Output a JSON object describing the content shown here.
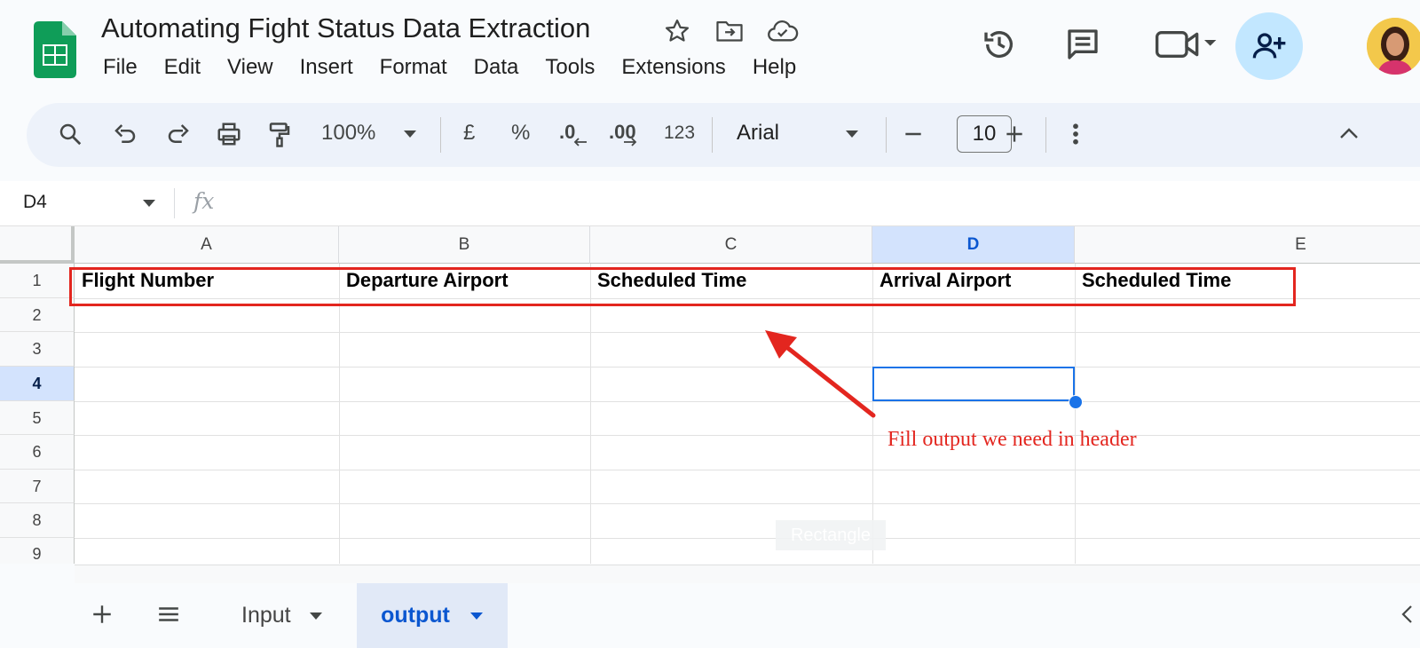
{
  "document": {
    "title": "Automating Fight Status Data Extraction"
  },
  "menu": [
    "File",
    "Edit",
    "View",
    "Insert",
    "Format",
    "Data",
    "Tools",
    "Extensions",
    "Help"
  ],
  "toolbar": {
    "zoom": "100%",
    "currency": "£",
    "percent": "%",
    "decrease_decimal": ".0",
    "increase_decimal": ".00",
    "number_format": "123",
    "font": "Arial",
    "font_size": "10"
  },
  "formula_bar": {
    "name_box": "D4",
    "fx": "fx",
    "formula": ""
  },
  "grid": {
    "columns": [
      "A",
      "B",
      "C",
      "D",
      "E"
    ],
    "selected_column": "D",
    "rows": [
      "1",
      "2",
      "3",
      "4",
      "5",
      "6",
      "7",
      "8",
      "9"
    ],
    "selected_row": "4",
    "header_row": [
      "Flight Number",
      "Departure Airport",
      "Scheduled Time",
      "Arrival Airport",
      "Scheduled Time"
    ]
  },
  "annotation": {
    "text": "Fill output we need in header",
    "color": "#e3261f"
  },
  "watermark": "Rectangle",
  "sheets": {
    "tabs": [
      {
        "label": "Input",
        "active": false
      },
      {
        "label": "output",
        "active": true
      }
    ]
  },
  "colors": {
    "accent": "#0b57d0",
    "selection": "#d3e3fd",
    "annotation": "#e3261f",
    "sheets_green": "#0f9d58"
  }
}
